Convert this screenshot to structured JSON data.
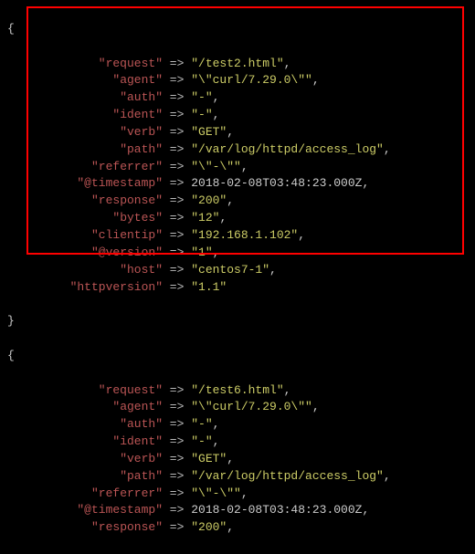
{
  "brace_open": "{",
  "brace_close": "}",
  "arrow": " => ",
  "block1": {
    "entries": [
      {
        "key": "\"request\"",
        "val": "\"/test2.html\"",
        "type": "str"
      },
      {
        "key": "\"agent\"",
        "val": "\"\\\"curl/7.29.0\\\"\"",
        "type": "str"
      },
      {
        "key": "\"auth\"",
        "val": "\"-\"",
        "type": "str"
      },
      {
        "key": "\"ident\"",
        "val": "\"-\"",
        "type": "str"
      },
      {
        "key": "\"verb\"",
        "val": "\"GET\"",
        "type": "str"
      },
      {
        "key": "\"path\"",
        "val": "\"/var/log/httpd/access_log\"",
        "type": "str"
      },
      {
        "key": "\"referrer\"",
        "val": "\"\\\"-\\\"\"",
        "type": "str"
      },
      {
        "key": "\"@timestamp\"",
        "val": "2018-02-08T03:48:23.000Z",
        "type": "plain"
      },
      {
        "key": "\"response\"",
        "val": "\"200\"",
        "type": "str"
      },
      {
        "key": "\"bytes\"",
        "val": "\"12\"",
        "type": "str"
      },
      {
        "key": "\"clientip\"",
        "val": "\"192.168.1.102\"",
        "type": "str"
      },
      {
        "key": "\"@version\"",
        "val": "\"1\"",
        "type": "str"
      },
      {
        "key": "\"host\"",
        "val": "\"centos7-1\"",
        "type": "str"
      },
      {
        "key": "\"httpversion\"",
        "val": "\"1.1\"",
        "type": "str"
      }
    ]
  },
  "block2": {
    "entries": [
      {
        "key": "\"request\"",
        "val": "\"/test6.html\"",
        "type": "str"
      },
      {
        "key": "\"agent\"",
        "val": "\"\\\"curl/7.29.0\\\"\"",
        "type": "str"
      },
      {
        "key": "\"auth\"",
        "val": "\"-\"",
        "type": "str"
      },
      {
        "key": "\"ident\"",
        "val": "\"-\"",
        "type": "str"
      },
      {
        "key": "\"verb\"",
        "val": "\"GET\"",
        "type": "str"
      },
      {
        "key": "\"path\"",
        "val": "\"/var/log/httpd/access_log\"",
        "type": "str"
      },
      {
        "key": "\"referrer\"",
        "val": "\"\\\"-\\\"\"",
        "type": "str"
      },
      {
        "key": "\"@timestamp\"",
        "val": "2018-02-08T03:48:23.000Z",
        "type": "plain"
      },
      {
        "key": "\"response\"",
        "val": "\"200\"",
        "type": "str"
      }
    ]
  }
}
